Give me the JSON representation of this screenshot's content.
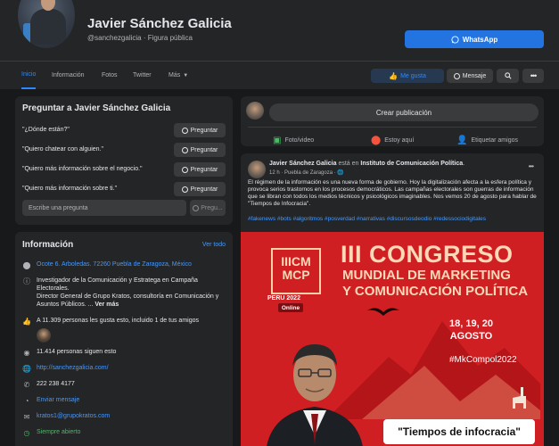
{
  "profile": {
    "name": "Javier Sánchez Galicia",
    "handle_line": "@sanchezgalicia · Figura pública",
    "whatsapp_label": "WhatsApp"
  },
  "nav": {
    "tabs": [
      "Inicio",
      "Información",
      "Fotos",
      "Twitter",
      "Más"
    ],
    "like_label": "Me gusta",
    "message_label": "Mensaje"
  },
  "ask": {
    "title": "Preguntar a Javier Sánchez Galicia",
    "questions": [
      "\"¿Dónde están?\"",
      "\"Quiero chatear con alguien.\"",
      "\"Quiero más información sobre el negocio.\"",
      "\"Quiero más información sobre ti.\""
    ],
    "ask_button": "Preguntar",
    "input_placeholder": "Escribe una pregunta",
    "submit_label": "Pregu..."
  },
  "info": {
    "title": "Información",
    "see_all": "Ver todo",
    "address": "Ocote 6. Arboledas. 72260 Puebla de Zaragoza, México",
    "bio_line1": "Investigador de la Comunicación y Estratega en Campaña Electorales.",
    "bio_line2": "Director General de Grupo Kratos, consultoría en Comunicación y Asuntos Públicos. ...",
    "see_more": "Ver más",
    "likes": "A 11.309 personas les gusta esto, incluido 1 de tus amigos",
    "followers": "11.414 personas siguen esto",
    "website": "http://sanchezgalicia.com/",
    "phone": "222 238 4177",
    "send_message": "Enviar mensaje",
    "email": "kratos1@grupokratos.com",
    "hours": "Siempre abierto"
  },
  "create_post": {
    "placeholder": "Crear publicación",
    "photo_video": "Foto/video",
    "here": "Estoy aquí",
    "tag_friends": "Etiquetar amigos"
  },
  "post": {
    "author": "Javier Sánchez Galicia",
    "in_text": "está en",
    "place": "Instituto de Comunicación Política",
    "time": "12 h · Puebla de Zaragoza ·",
    "text": "El régimen de la información es una nueva forma de gobierno. Hoy la digitalización afecta a la esfera política y provoca serios trastornos en los procesos democráticos. Las campañas electorales son guerras de información que se libran con todos los medios técnicos y psicológicos imaginables. Nos vemos 20 de agosto para hablar de \"Tiempos de Infocracia\".",
    "hashtags": "#fakenews #bots #algoritmos #posverdad #narrativas #discursosdeodio #redessociodigitales"
  },
  "poster": {
    "logo_l1": "IIICM",
    "logo_l2": "MCP",
    "logo_peru": "PERU 2022",
    "online": "Online",
    "title1": "III CONGRESO",
    "title2": "MUNDIAL DE MARKETING",
    "title3": "Y COMUNICACIÓN POLÍTICA",
    "dates_l1": "18, 19, 20",
    "dates_l2": "AGOSTO",
    "hashtag": "#MkCompol2022",
    "tagline": "\"Tiempos de infocracia\""
  }
}
